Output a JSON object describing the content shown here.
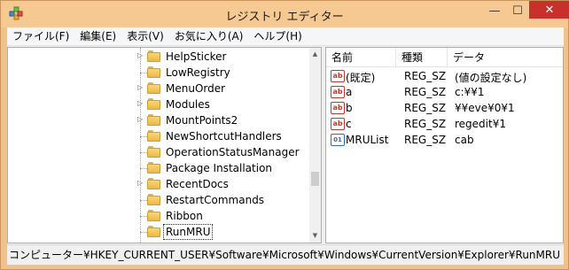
{
  "window": {
    "title": "レジストリ エディター",
    "icon": "registry-editor-icon",
    "controls": {
      "minimize": "—",
      "maximize": "☐",
      "close": "✕"
    }
  },
  "menu": [
    "ファイル(F)",
    "編集(E)",
    "表示(V)",
    "お気に入り(A)",
    "ヘルプ(H)"
  ],
  "tree": {
    "items": [
      {
        "label": "HelpSticker",
        "expandable": true
      },
      {
        "label": "LowRegistry",
        "expandable": false
      },
      {
        "label": "MenuOrder",
        "expandable": true
      },
      {
        "label": "Modules",
        "expandable": true
      },
      {
        "label": "MountPoints2",
        "expandable": true
      },
      {
        "label": "NewShortcutHandlers",
        "expandable": false
      },
      {
        "label": "OperationStatusManager",
        "expandable": false
      },
      {
        "label": "Package Installation",
        "expandable": false
      },
      {
        "label": "RecentDocs",
        "expandable": true
      },
      {
        "label": "RestartCommands",
        "expandable": false
      },
      {
        "label": "Ribbon",
        "expandable": false
      },
      {
        "label": "RunMRU",
        "expandable": false,
        "selected": true
      }
    ]
  },
  "list": {
    "columns": {
      "name": "名前",
      "type": "種類",
      "data": "データ"
    },
    "rows": [
      {
        "icon": "ab",
        "name": "(既定)",
        "type": "REG_SZ",
        "data": "(値の設定なし)"
      },
      {
        "icon": "ab",
        "name": "a",
        "type": "REG_SZ",
        "data": "c:¥¥1"
      },
      {
        "icon": "ab",
        "name": "b",
        "type": "REG_SZ",
        "data": "¥¥eve¥0¥1"
      },
      {
        "icon": "ab",
        "name": "c",
        "type": "REG_SZ",
        "data": "regedit¥1"
      },
      {
        "icon": "binary",
        "name": "MRUList",
        "type": "REG_SZ",
        "data": "cab"
      }
    ]
  },
  "status": "コンピューター¥HKEY_CURRENT_USER¥Software¥Microsoft¥Windows¥CurrentVersion¥Explorer¥RunMRU"
}
